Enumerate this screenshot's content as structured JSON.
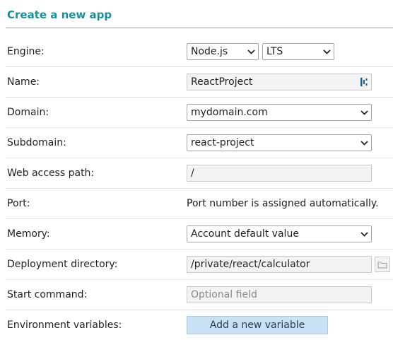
{
  "heading": "Create a new app",
  "fields": {
    "engine": {
      "label": "Engine:",
      "value": "Node.js",
      "version": "LTS"
    },
    "name": {
      "label": "Name:",
      "value": "ReactProject",
      "icon": "autofill-icon"
    },
    "domain": {
      "label": "Domain:",
      "value": "mydomain.com"
    },
    "subdomain": {
      "label": "Subdomain:",
      "value": "react-project"
    },
    "web_access_path": {
      "label": "Web access path:",
      "value": "/"
    },
    "port": {
      "label": "Port:",
      "value": "Port number is assigned automatically."
    },
    "memory": {
      "label": "Memory:",
      "value": "Account default value"
    },
    "deployment_directory": {
      "label": "Deployment directory:",
      "value": "/private/react/calculator",
      "icon": "folder-icon"
    },
    "start_command": {
      "label": "Start command:",
      "placeholder": "Optional field",
      "value": ""
    },
    "environment_variables": {
      "label": "Environment variables:",
      "button": "Add a new variable"
    }
  },
  "colors": {
    "heading": "#1a8f9a",
    "button_bg": "#c8e2f4",
    "input_bg": "#f3f3f3"
  }
}
